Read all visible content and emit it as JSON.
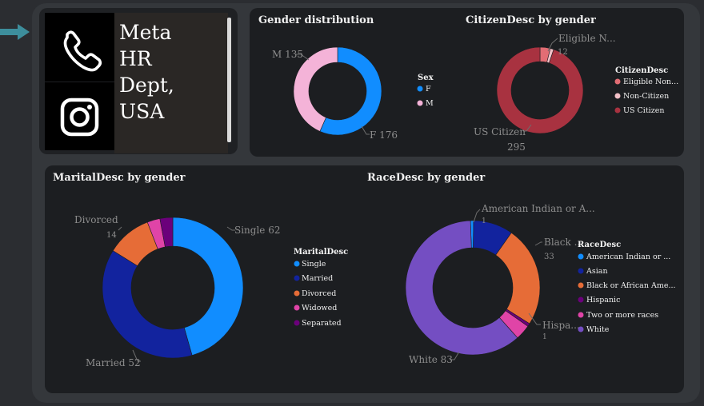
{
  "company": {
    "line1": "Meta",
    "line2": "HR",
    "line3": "Dept,",
    "line4": "USA",
    "icons": [
      "phone-icon",
      "instagram-icon"
    ]
  },
  "chart_data": [
    {
      "type": "pie",
      "variant": "donut",
      "title": "Gender distribution",
      "legend_title": "Sex",
      "categories": [
        "F",
        "M"
      ],
      "values": [
        176,
        135
      ],
      "colors": [
        "#118dff",
        "#f4b3d8"
      ],
      "data_labels": [
        "F 176",
        "M 135"
      ]
    },
    {
      "type": "pie",
      "variant": "donut",
      "title": "CitizenDesc by gender",
      "legend_title": "CitizenDesc",
      "categories": [
        "Eligible NonCitizen",
        "Non-Citizen",
        "US Citizen"
      ],
      "legend_labels": [
        "Eligible Non...",
        "Non-Citizen",
        "US Citizen"
      ],
      "values": [
        12,
        4,
        295
      ],
      "colors": [
        "#e26d74",
        "#f2c0c7",
        "#a83240"
      ],
      "data_labels": [
        "Eligible N...",
        "12",
        "US Citizen",
        "295"
      ]
    },
    {
      "type": "pie",
      "variant": "donut",
      "title": "MaritalDesc by gender",
      "legend_title": "MaritalDesc",
      "categories": [
        "Single",
        "Married",
        "Divorced",
        "Widowed",
        "Separated"
      ],
      "values": [
        62,
        52,
        14,
        4,
        4
      ],
      "colors": [
        "#118dff",
        "#12239e",
        "#e66c37",
        "#e044a7",
        "#6b007b"
      ],
      "data_labels": [
        "Single 62",
        "Married 52",
        "Divorced",
        "14"
      ]
    },
    {
      "type": "pie",
      "variant": "donut",
      "title": "RaceDesc by gender",
      "legend_title": "RaceDesc",
      "categories": [
        "American Indian or Alaska Native",
        "Asian",
        "Black or African American",
        "Hispanic",
        "Two or more races",
        "White"
      ],
      "legend_labels": [
        "American Indian or ...",
        "Asian",
        "Black or African Ame...",
        "Hispanic",
        "Two or more races",
        "White"
      ],
      "values": [
        1,
        13,
        33,
        1,
        5,
        83
      ],
      "colors": [
        "#118dff",
        "#12239e",
        "#e66c37",
        "#6b007b",
        "#e044a7",
        "#744ec2"
      ],
      "data_labels": [
        "American Indian or A...",
        "1",
        "Black ...",
        "33",
        "Hispa...",
        "1",
        "White 83"
      ]
    }
  ]
}
